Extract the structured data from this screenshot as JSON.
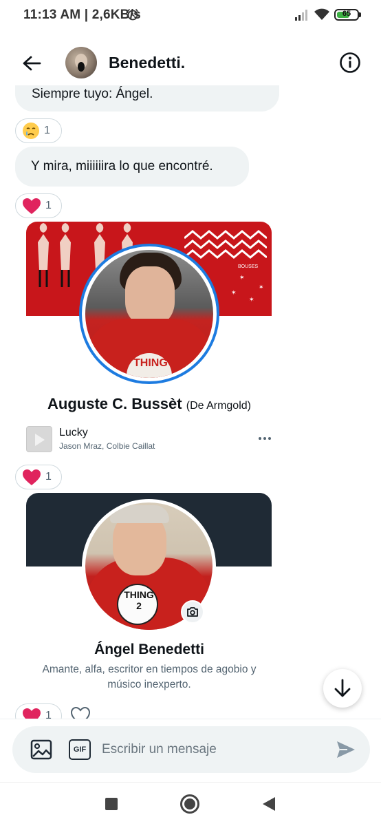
{
  "status_bar": {
    "time_speed": "11:13 AM | 2,6KB/s",
    "battery_level": "65",
    "battery_fraction": 0.65
  },
  "header": {
    "title": "Benedetti.",
    "back_icon": "arrow-left-icon",
    "info_icon": "info-circle-icon"
  },
  "messages": {
    "partial_text": "Siempre tuyo: Ángel.",
    "reaction_1": {
      "emoji": "😢",
      "count": "1"
    },
    "message_2": "Y mira, miiiiiira lo que encontré.",
    "reaction_2": {
      "emoji": "❤",
      "count": "1"
    },
    "reaction_3": {
      "emoji": "❤",
      "count": "1"
    },
    "reaction_4": {
      "emoji": "❤",
      "count": "1"
    }
  },
  "profile_card_1": {
    "name": "Auguste C. Bussèt",
    "name_suffix": "(De Armgold)",
    "badge_text": "THING",
    "banner_text": "BOUSES",
    "song": {
      "title": "Lucky",
      "artist": "Jason Mraz, Colbie Caillat"
    }
  },
  "profile_card_2": {
    "name": "Ángel Benedetti",
    "bio": "Amante, alfa, escritor en tiempos de agobio y músico inexperto.",
    "badge_text": "THING 2"
  },
  "composer": {
    "placeholder": "Escribir un mensaje",
    "gif_label": "GIF"
  },
  "colors": {
    "accent": "#1d9bf0",
    "heart": "#f91880",
    "banner_red": "#c8161b",
    "banner_dark": "#1f2a35"
  }
}
